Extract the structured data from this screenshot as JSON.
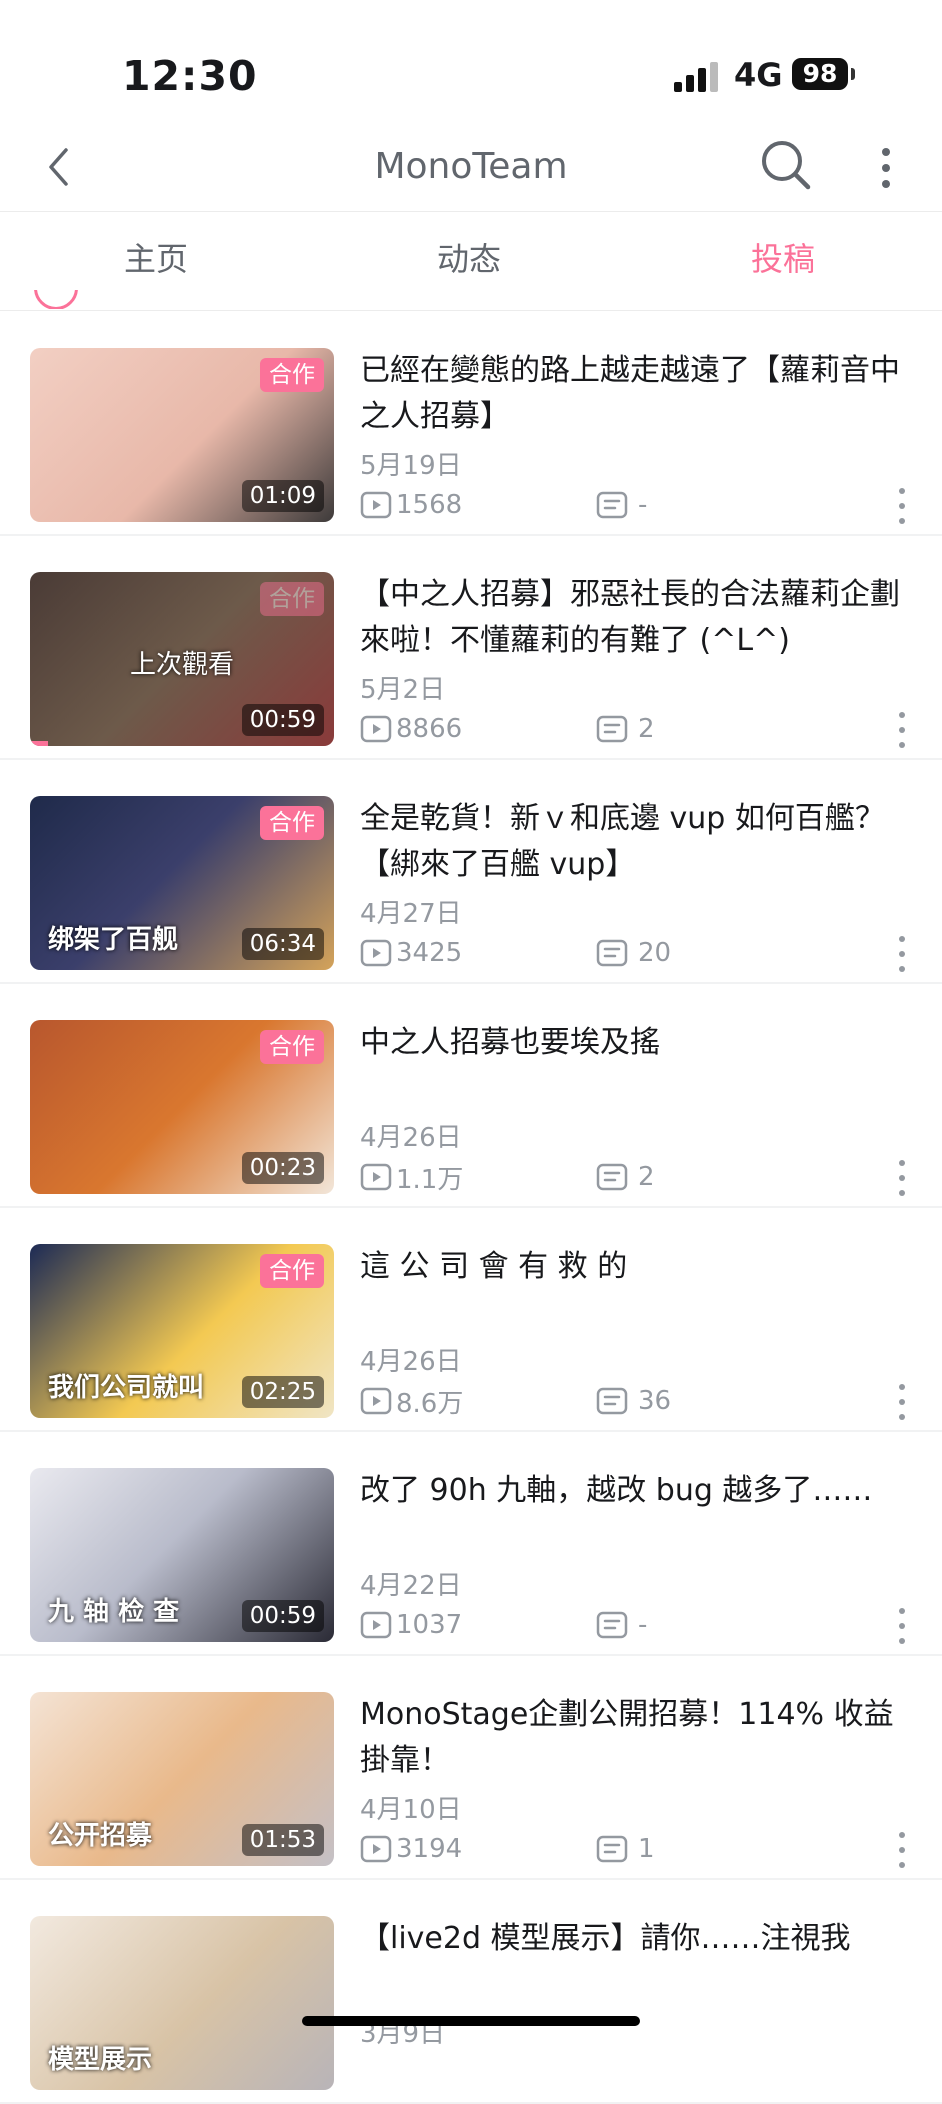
{
  "status_bar": {
    "time": "12:30",
    "network": "4G",
    "battery": "98"
  },
  "header": {
    "title": "MonoTeam"
  },
  "tabs": [
    {
      "label": "主页",
      "active": false
    },
    {
      "label": "动态",
      "active": false
    },
    {
      "label": "投稿",
      "active": true
    }
  ],
  "colors": {
    "accent": "#fb7299",
    "muted": "#9499a0",
    "text": "#18191c"
  },
  "videos": [
    {
      "title": "已經在變態的路上越走越遠了【蘿莉音中之人招募】",
      "date": "5月19日",
      "views": "1568",
      "comments": "-",
      "duration": "01:09",
      "badge": "合作",
      "thumb_caption": ""
    },
    {
      "title": "【中之人招募】邪惡社長的合法蘿莉企劃來啦！不懂蘿莉的有難了 (^L^)",
      "date": "5月2日",
      "views": "8866",
      "comments": "2",
      "duration": "00:59",
      "badge": "合作",
      "thumb_caption": "",
      "watched_label": "上次觀看"
    },
    {
      "title": "全是乾貨！新ｖ和底邊 vup 如何百艦？【綁來了百艦 vup】",
      "date": "4月27日",
      "views": "3425",
      "comments": "20",
      "duration": "06:34",
      "badge": "合作",
      "thumb_caption": "绑架了百舰"
    },
    {
      "title": "中之人招募也要埃及搖",
      "date": "4月26日",
      "views": "1.1万",
      "comments": "2",
      "duration": "00:23",
      "badge": "合作",
      "thumb_caption": ""
    },
    {
      "title": "這 公 司 會 有 救 的",
      "date": "4月26日",
      "views": "8.6万",
      "comments": "36",
      "duration": "02:25",
      "badge": "合作",
      "thumb_caption": "我们公司就叫"
    },
    {
      "title": "改了 90h 九軸，越改 bug 越多了……",
      "date": "4月22日",
      "views": "1037",
      "comments": "-",
      "duration": "00:59",
      "badge": "",
      "thumb_caption": "九 轴 检 查"
    },
    {
      "title": "MonoStage企劃公開招募！114% 收益掛靠！",
      "date": "4月10日",
      "views": "3194",
      "comments": "1",
      "duration": "01:53",
      "badge": "",
      "thumb_caption": "公开招募"
    },
    {
      "title": "【live2d 模型展示】請你……注視我",
      "date": "3月9日",
      "views": "",
      "comments": "",
      "duration": "",
      "badge": "",
      "thumb_caption": "模型展示"
    }
  ]
}
